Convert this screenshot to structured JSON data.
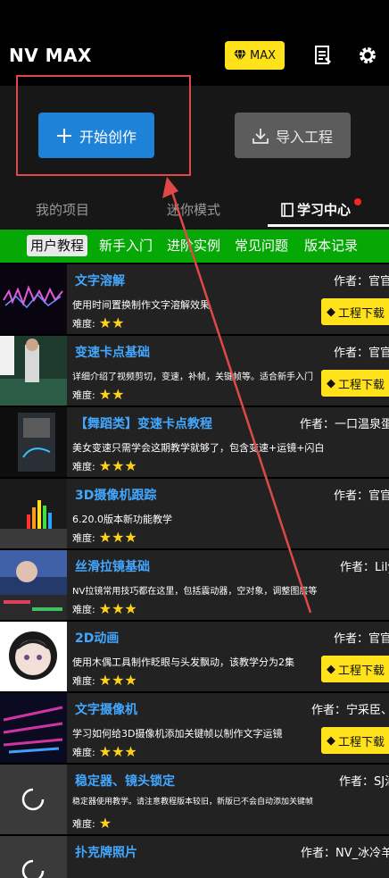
{
  "app": {
    "name": "NV MAX",
    "max_label": "MAX",
    "create_label": "开始创作",
    "import_label": "导入工程"
  },
  "main_tabs": [
    "我的项目",
    "迷你模式",
    "学习中心"
  ],
  "sub_tabs": [
    "用户教程",
    "新手入门",
    "进阶实例",
    "常见问题",
    "版本记录"
  ],
  "labels": {
    "difficulty": "难度:",
    "download": "工程下载"
  },
  "cards": [
    {
      "title": "文字溶解",
      "author": "作者：官官",
      "desc": "使用时间置换制作文字溶解效果",
      "stars": "★★",
      "download": true
    },
    {
      "title": "变速卡点基础",
      "author": "作者：官官",
      "desc": "详细介绍了视频剪切，变速，补帧，关键帧等。适合新手入门",
      "stars": "★★",
      "download": true
    },
    {
      "title": "【舞蹈类】变速卡点教程",
      "author": "作者：一口温泉蛋",
      "desc": "美女变速只需学会这期教学就够了，包含变速+运镜+闪白",
      "stars": "★★★",
      "download": false
    },
    {
      "title": "3D摄像机跟踪",
      "author": "作者：官官",
      "desc": "6.20.0版本新功能教学",
      "stars": "★★★",
      "download": false
    },
    {
      "title": "丝滑拉镜基础",
      "author": "作者：Lily",
      "desc": "NV拉镜常用技巧都在这里，包括震动器，空对象，调整图层等",
      "stars": "★★★",
      "download": false
    },
    {
      "title": "2D动画",
      "author": "作者：官官",
      "desc": "使用木偶工具制作眨眼与头发飘动，该教学分为2集",
      "stars": "★★★",
      "download": true
    },
    {
      "title": "文字摄像机",
      "author": "作者：宁采臣、",
      "desc": "学习如何给3D摄像机添加关键帧以制作文字运镜",
      "stars": "★★★",
      "download": true
    },
    {
      "title": "稳定器、镜头锁定",
      "author": "作者：SJ汕治",
      "desc": "稳定器使用教学。请注意教程版本较旧，新版已不会自动添加关键帧",
      "stars": "★",
      "download": false
    },
    {
      "title": "扑克牌照片",
      "author": "作者：NV_冰冷羊",
      "desc": "",
      "stars": "",
      "download": false
    }
  ],
  "colors": {
    "accent_blue": "#1e82d8",
    "green_bar": "#05a805",
    "yellow": "#ffe21a",
    "title_blue": "#42a8ff"
  }
}
